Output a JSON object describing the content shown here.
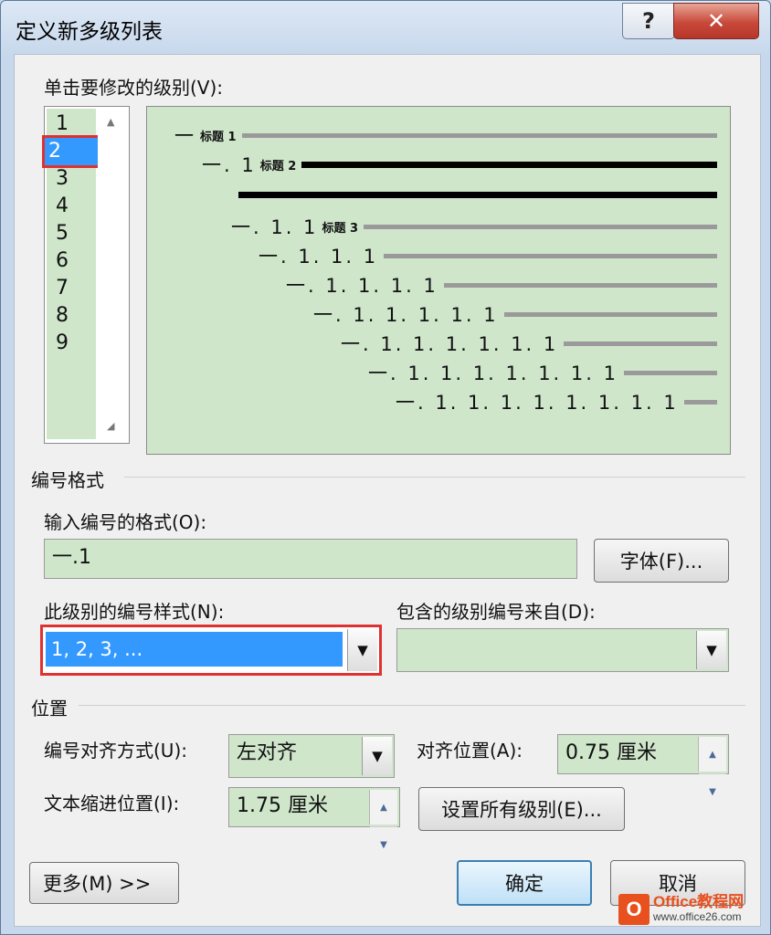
{
  "window": {
    "title": "定义新多级列表",
    "help_glyph": "?",
    "close_glyph": "✕"
  },
  "levels_section": {
    "label": "单击要修改的级别(V):",
    "items": [
      "1",
      "2",
      "3",
      "4",
      "5",
      "6",
      "7",
      "8",
      "9"
    ],
    "selected_index": 1
  },
  "preview": {
    "lines": [
      {
        "num": "一",
        "text": "标题 1"
      },
      {
        "num": "一. 1",
        "text": "标题 2"
      },
      {
        "num": "",
        "text": ""
      },
      {
        "num": "一. 1. 1",
        "text": "标题 3"
      },
      {
        "num": "一. 1. 1. 1",
        "text": ""
      },
      {
        "num": "一. 1. 1. 1. 1",
        "text": ""
      },
      {
        "num": "一. 1. 1. 1. 1. 1",
        "text": ""
      },
      {
        "num": "一. 1. 1. 1. 1. 1. 1",
        "text": ""
      },
      {
        "num": "一. 1. 1. 1. 1. 1. 1. 1",
        "text": ""
      },
      {
        "num": "一. 1. 1. 1. 1. 1. 1. 1. 1",
        "text": ""
      }
    ]
  },
  "number_format": {
    "section_label": "编号格式",
    "input_label": "输入编号的格式(O):",
    "input_value": "一.1",
    "font_button": "字体(F)...",
    "style_label": "此级别的编号样式(N):",
    "style_value": "1, 2, 3, ...",
    "include_label": "包含的级别编号来自(D):",
    "include_value": ""
  },
  "position": {
    "section_label": "位置",
    "align_label": "编号对齐方式(U):",
    "align_value": "左对齐",
    "align_at_label": "对齐位置(A):",
    "align_at_value": "0.75 厘米",
    "indent_label": "文本缩进位置(I):",
    "indent_value": "1.75 厘米",
    "set_all_button": "设置所有级别(E)..."
  },
  "footer": {
    "more_button": "更多(M) >>",
    "ok_button": "确定",
    "cancel_button": "取消"
  },
  "watermark": {
    "logo_letter": "O",
    "line1": "Office教程网",
    "line2": "www.office26.com"
  },
  "colors": {
    "selection": "#3399ff",
    "highlight_box": "#e03131",
    "field_bg": "#cfe6cb"
  }
}
